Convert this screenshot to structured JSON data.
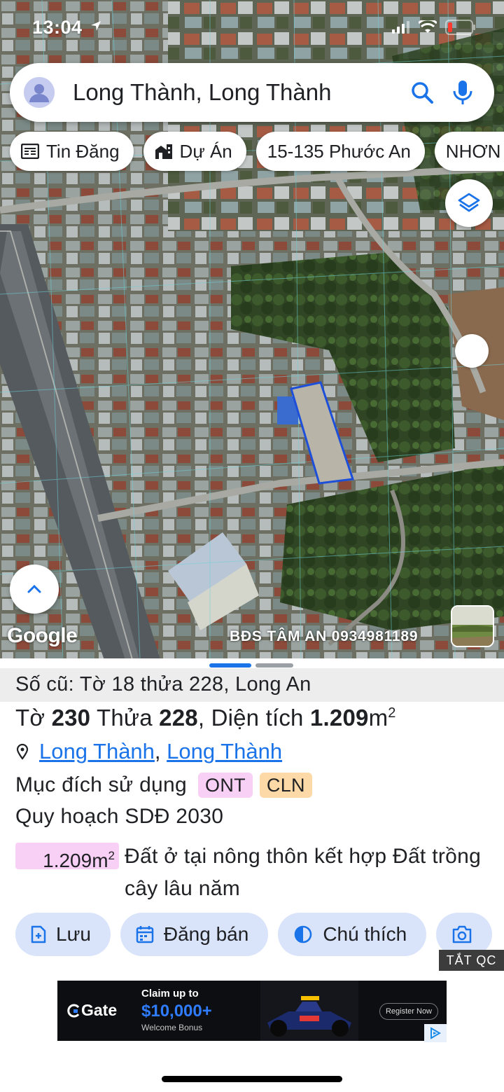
{
  "status_bar": {
    "time": "13:04"
  },
  "search": {
    "query": "Long Thành, Long Thành"
  },
  "chips": [
    {
      "label": "Tin Đăng",
      "icon": "newspaper-icon"
    },
    {
      "label": "Dự Án",
      "icon": "building-icon"
    },
    {
      "label": "15-135 Phước An",
      "icon": ""
    },
    {
      "label": "NHƠN T",
      "icon": ""
    }
  ],
  "map": {
    "google_logo": "Google",
    "watermark": "BĐS TÂM AN 0934981189"
  },
  "parcel": {
    "old_ref": "Số cũ: Tờ 18 thửa 228, Long An",
    "title_prefix": "Tờ ",
    "sheet_no": "230",
    "title_mid": " Thửa ",
    "parcel_no": "228",
    "title_area_label": ", Diện tích ",
    "area": "1.209",
    "area_unit": "m",
    "area_unit_sup": "2",
    "location_link_1": "Long Thành",
    "location_sep": ", ",
    "location_link_2": "Long Thành",
    "usage_label": "Mục đích sử dụng",
    "usage_tags": [
      "ONT",
      "CLN"
    ],
    "plan_label": "Quy hoạch SDĐ 2030",
    "plan_area": "1.209m",
    "plan_area_sup": "2",
    "plan_desc": "Đất ở tại nông thôn kết hợp Đất trồng cây lâu năm"
  },
  "actions": [
    {
      "label": "Lưu",
      "icon": "add-document-icon"
    },
    {
      "label": "Đăng bán",
      "icon": "calendar-icon"
    },
    {
      "label": "Chú thích",
      "icon": "contrast-icon"
    },
    {
      "label": "",
      "icon": "camera-icon"
    }
  ],
  "ad": {
    "close_label": "TẮT QC",
    "brand": "Gate",
    "claim": "Claim up to",
    "amount": "$10,000+",
    "bonus": "Welcome Bonus",
    "register": "Register Now"
  },
  "colors": {
    "accent": "#1a73e8",
    "action_bg": "#d9e4fb",
    "tag_ont": "#f9d0f5",
    "tag_cln": "#fdd9a8",
    "parcel_outline": "#1e4fd8"
  }
}
